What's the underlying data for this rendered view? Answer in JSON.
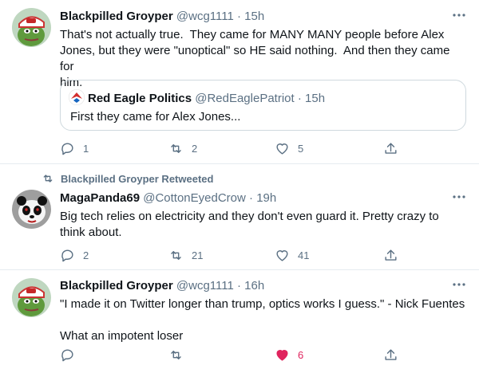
{
  "tweets": [
    {
      "name": "Blackpilled Groyper",
      "handle": "@wcg1111",
      "time": "15h",
      "text": "That's not actually true.  They came for MANY MANY people before Alex\nJones, but they were \"unoptical\" so HE said nothing.  And then they came for\nhim.",
      "quote": {
        "name": "Red Eagle Politics",
        "handle": "@RedEaglePatriot",
        "time": "15h",
        "text": "First they came for Alex Jones..."
      },
      "replies": "1",
      "retweets": "2",
      "likes": "5"
    },
    {
      "retweeted_by": "Blackpilled Groyper Retweeted",
      "name": "MagaPanda69",
      "handle": "@CottonEyedCrow",
      "time": "19h",
      "text": "Big tech relies on electricity and they don't even guard it. Pretty crazy to\nthink about.",
      "replies": "2",
      "retweets": "21",
      "likes": "41"
    },
    {
      "name": "Blackpilled Groyper",
      "handle": "@wcg1111",
      "time": "16h",
      "text": "\"I made it on Twitter longer than trump, optics works I guess.\" - Nick Fuentes\n\nWhat an impotent loser",
      "likes": "6"
    }
  ],
  "separator": "·",
  "colors": {
    "like_active": "#e0245e",
    "secondary_text": "#5b7083",
    "border": "#e6ecf0"
  },
  "icons": [
    "more-icon",
    "reply-icon",
    "retweet-icon",
    "like-icon",
    "share-icon",
    "avatar-pepe-icon",
    "avatar-panda-icon",
    "red-eagle-avatar-icon"
  ]
}
